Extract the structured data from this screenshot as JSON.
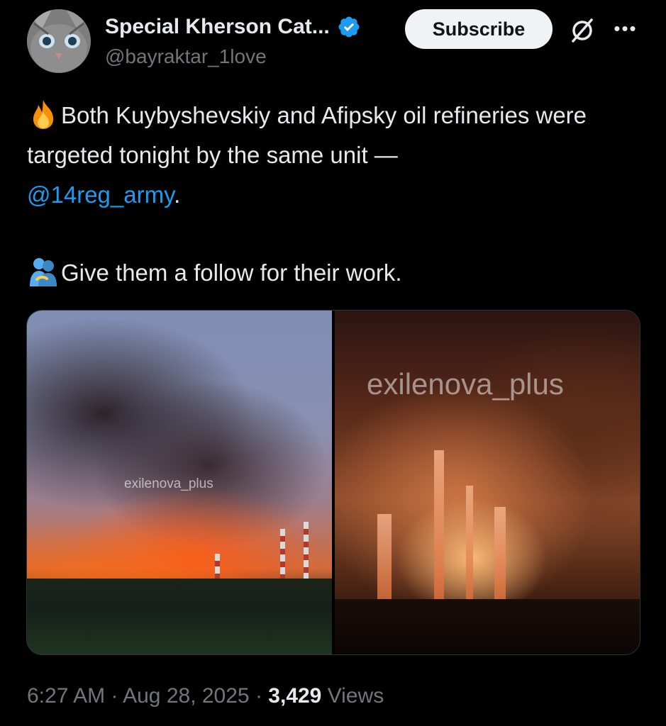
{
  "author": {
    "display_name": "Special Kherson Cat...",
    "handle": "@bayraktar_1love",
    "verified": true
  },
  "actions": {
    "subscribe_label": "Subscribe",
    "grok_icon": "grok-icon",
    "more_icon": "more-options-icon"
  },
  "tweet": {
    "line1_emoji": "fire",
    "line1_text": "Both Kuyby­shevskiy and Afipsky oil refineries were targeted tonight by the same unit —",
    "mention": "@14reg_army",
    "mention_suffix": ".",
    "line2_emoji": "people-hugging",
    "line2_text": "Give them a follow for their work."
  },
  "media": {
    "left_watermark": "exilenova_plus",
    "right_watermark": "exilenova_plus"
  },
  "meta": {
    "time": "6:27 AM",
    "separator": "·",
    "date": "Aug 28, 2025",
    "views_count": "3,429",
    "views_label": "Views"
  },
  "colors": {
    "background": "#000000",
    "text": "#e7e9ea",
    "secondary": "#71767b",
    "link": "#1d9bf0",
    "verified": "#1d9bf0"
  }
}
